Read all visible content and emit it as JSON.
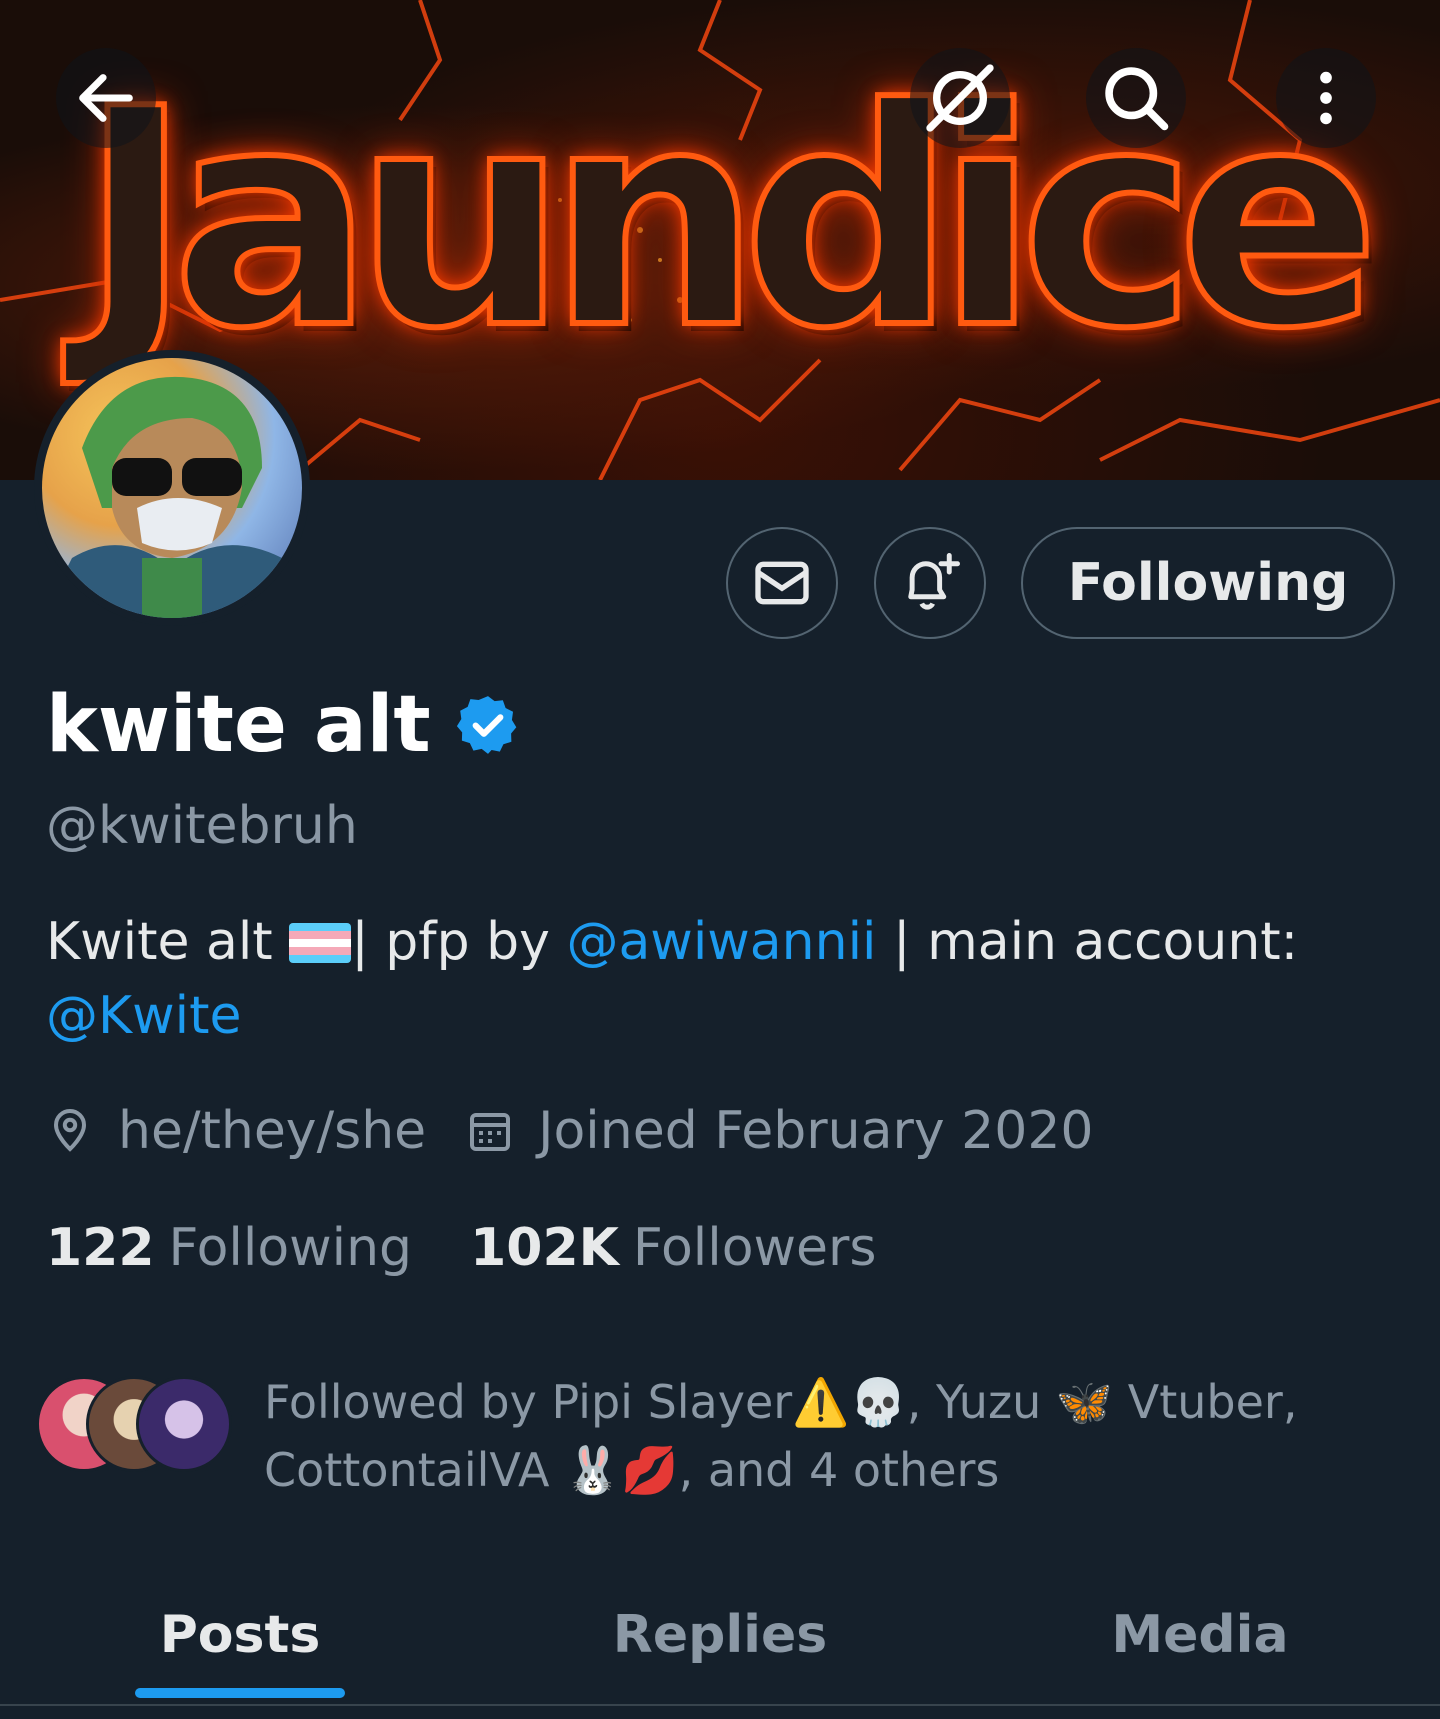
{
  "banner": {
    "text": "Jaundice"
  },
  "topbar": {
    "back_icon": "arrow-left-icon",
    "grok_icon": "grok-icon",
    "search_icon": "search-icon",
    "more_icon": "more-vertical-icon"
  },
  "actions": {
    "message_icon": "envelope-icon",
    "notify_icon": "bell-plus-icon",
    "follow_label": "Following"
  },
  "profile": {
    "name": "kwite alt",
    "verified_icon": "verified-badge-icon",
    "handle": "@kwitebruh",
    "bio": {
      "part1": "Kwite alt ",
      "part2": "| pfp by ",
      "mention1": "@awiwannii",
      "part3": " | main account:",
      "mention2": "@Kwite"
    },
    "pronouns": "he/they/she",
    "joined": "Joined February 2020"
  },
  "stats": {
    "following_count": "122",
    "following_label": "Following",
    "followers_count": "102K",
    "followers_label": "Followers"
  },
  "followed_by": {
    "line1": "Followed by Pipi Slayer⚠️💀, Yuzu 🦋 Vtuber,",
    "line2": "CottontailVA 🐰💋, and 4 others"
  },
  "tabs": [
    {
      "label": "Posts",
      "active": true
    },
    {
      "label": "Replies",
      "active": false
    },
    {
      "label": "Media",
      "active": false
    }
  ],
  "colors": {
    "background": "#15202b",
    "accent": "#1d9bf0",
    "muted": "#8b98a5"
  }
}
